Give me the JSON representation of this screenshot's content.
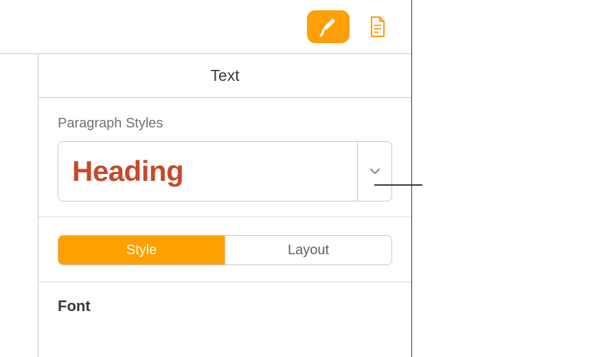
{
  "toolbar": {
    "format_button": "format",
    "document_button": "document"
  },
  "panel": {
    "title": "Text"
  },
  "paragraph_styles": {
    "label": "Paragraph Styles",
    "selected": "Heading"
  },
  "tabs": {
    "style": "Style",
    "layout": "Layout"
  },
  "font": {
    "label": "Font"
  },
  "colors": {
    "accent": "#ff9f0a",
    "heading_text": "#c54a2b"
  }
}
